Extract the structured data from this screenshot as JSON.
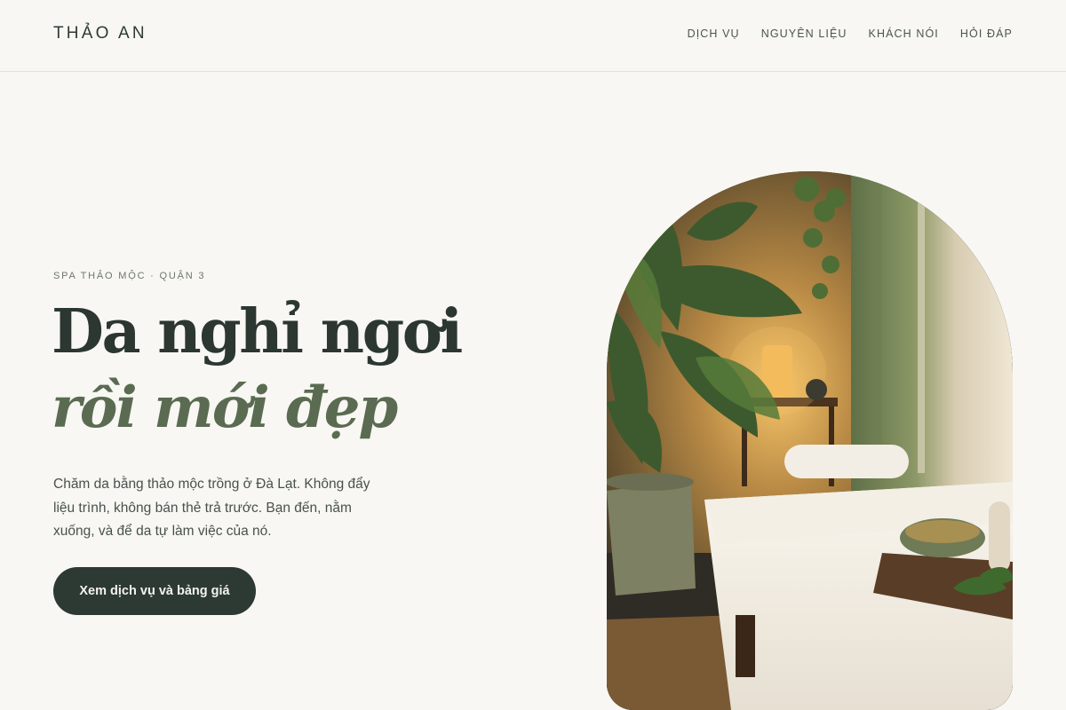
{
  "header": {
    "brand": "THẢO AN",
    "nav": [
      "DỊCH VỤ",
      "NGUYÊN LIỆU",
      "KHÁCH NÓI",
      "HỎI ĐÁP"
    ]
  },
  "hero": {
    "eyebrow": "SPA THẢO MỘC · QUẬN 3",
    "headline_line1": "Da nghỉ ngơi",
    "headline_line2": "rồi mới đẹp",
    "intro": "Chăm da bằng thảo mộc trồng ở Đà Lạt. Không đẩy liệu trình, không bán thẻ trả trước. Bạn đến, nằm xuống, và để da tự làm việc của nó.",
    "cta_label": "Xem dịch vụ và bảng giá"
  },
  "colors": {
    "background": "#f8f7f3",
    "ink": "#2b3730",
    "accent_green": "#5a6b51",
    "button": "#2c3a33"
  }
}
